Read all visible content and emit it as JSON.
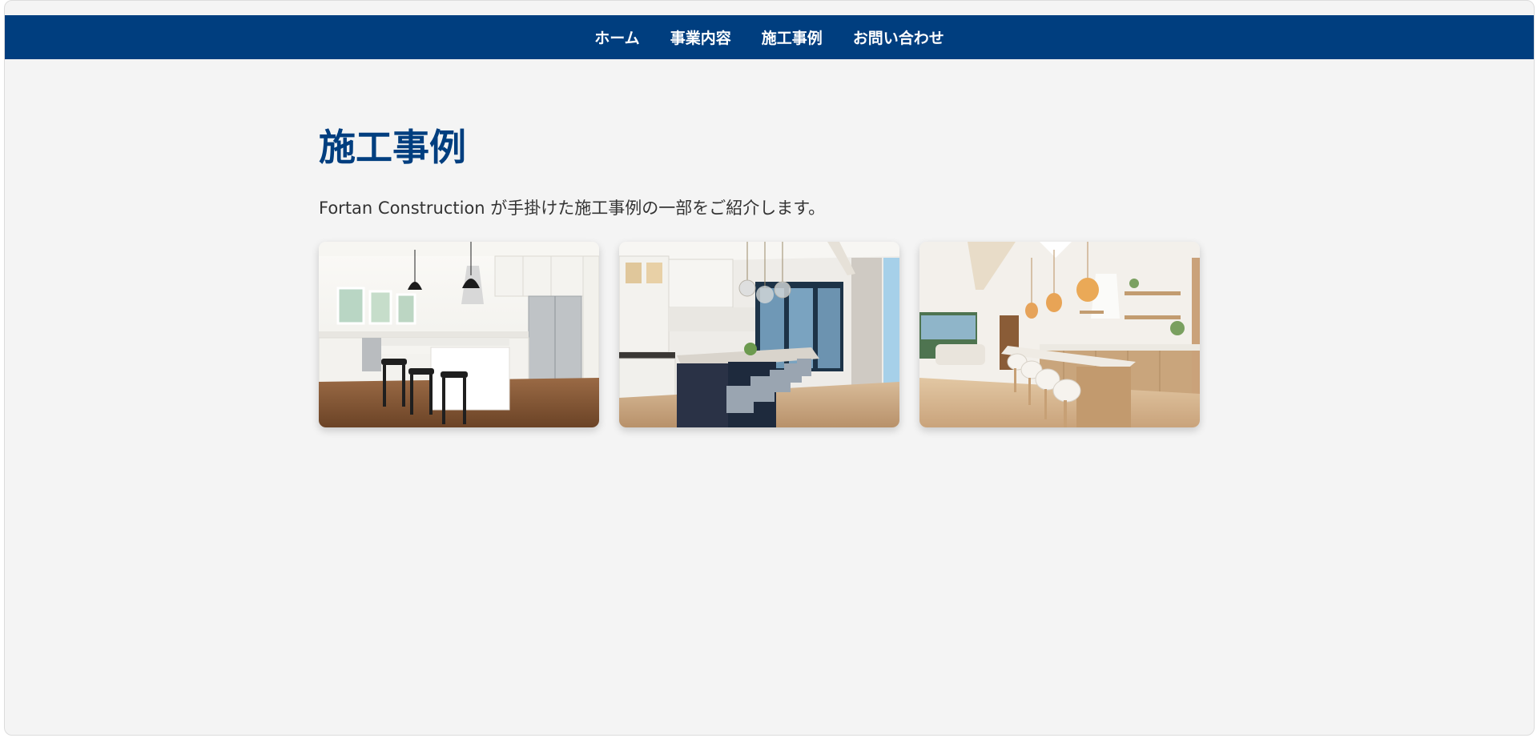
{
  "nav": {
    "items": [
      {
        "label": "ホーム"
      },
      {
        "label": "事業内容"
      },
      {
        "label": "施工事例"
      },
      {
        "label": "お問い合わせ"
      }
    ]
  },
  "main": {
    "title": "施工事例",
    "intro": "Fortan Construction が手掛けた施工事例の一部をご紹介します。"
  },
  "gallery": {
    "images": [
      {
        "name": "kitchen-photo-1"
      },
      {
        "name": "kitchen-photo-2"
      },
      {
        "name": "kitchen-photo-3"
      }
    ]
  },
  "colors": {
    "brand": "#003e7f",
    "background": "#f4f4f4",
    "text": "#333333"
  }
}
